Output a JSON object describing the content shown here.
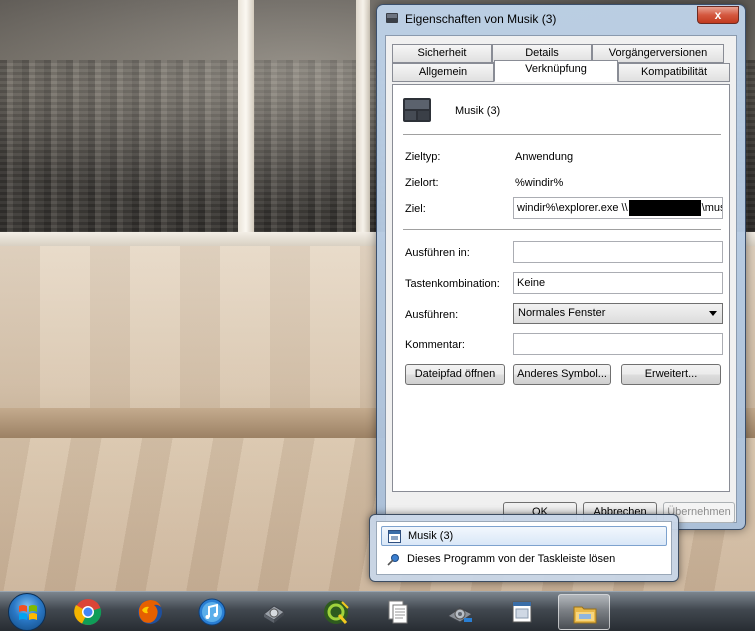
{
  "window": {
    "title": "Eigenschaften von Musik (3)",
    "close_label": "x"
  },
  "tabs": {
    "row_top": [
      "Sicherheit",
      "Details",
      "Vorgängerversionen"
    ],
    "row_bottom": [
      "Allgemein",
      "Verknüpfung",
      "Kompatibilität"
    ],
    "active": "Verknüpfung"
  },
  "shortcut": {
    "name": "Musik (3)",
    "target_type_label": "Zieltyp:",
    "target_type_value": "Anwendung",
    "target_location_label": "Zielort:",
    "target_location_value": "%windir%",
    "target_label": "Ziel:",
    "target_value_start": "windir%\\explorer.exe \\\\",
    "target_value_end": "\\music",
    "start_in_label": "Ausführen in:",
    "start_in_value": "",
    "hotkey_label": "Tastenkombination:",
    "hotkey_value": "Keine",
    "run_label": "Ausführen:",
    "run_value": "Normales Fenster",
    "comment_label": "Kommentar:",
    "comment_value": ""
  },
  "buttons": {
    "open_path": "Dateipfad öffnen",
    "change_icon": "Anderes Symbol...",
    "advanced": "Erweitert...",
    "ok": "OK",
    "cancel": "Abbrechen",
    "apply": "Übernehmen"
  },
  "jumplist": {
    "items": [
      "Musik (3)",
      "Dieses Programm von der Taskleiste lösen"
    ]
  },
  "taskbar": {
    "icons": [
      "chrome-icon",
      "firefox-icon",
      "itunes-icon",
      "hard-drive-icon",
      "quicktime-x-icon",
      "documents-icon",
      "network-icon",
      "window-app-icon",
      "explorer-folder-icon"
    ]
  },
  "colors": {
    "window_glass": "#aac0da",
    "taskbar": "#2b3036",
    "accent": "#2a78c6"
  }
}
